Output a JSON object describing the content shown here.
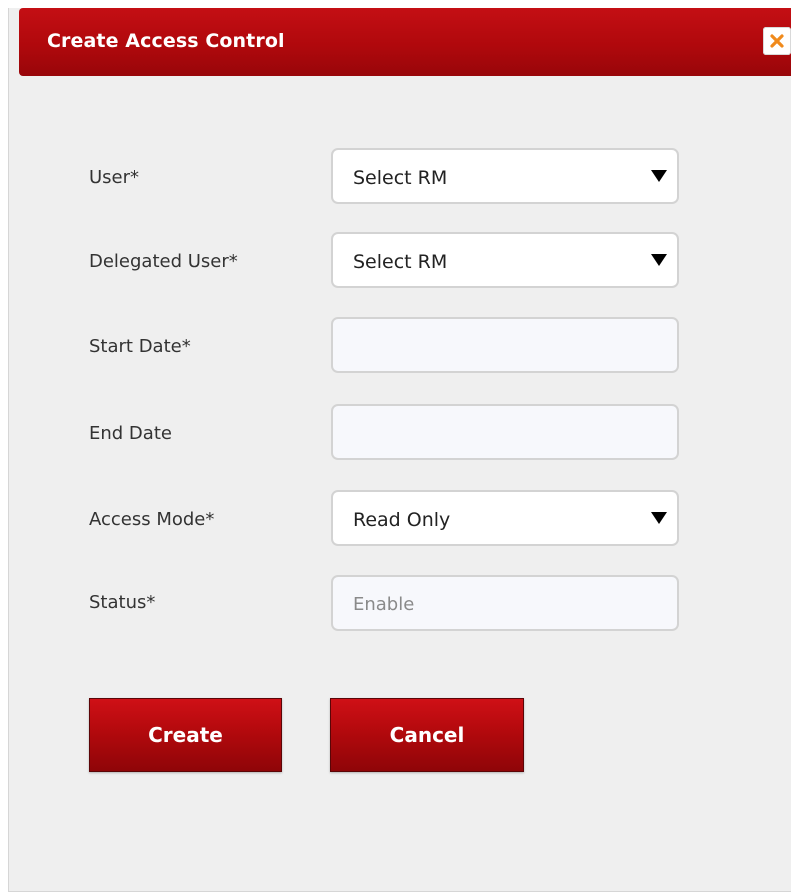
{
  "dialog": {
    "title": "Create Access Control",
    "close_icon": "close-icon"
  },
  "form": {
    "user": {
      "label": "User*",
      "value": "Select RM"
    },
    "delegated_user": {
      "label": "Delegated User*",
      "value": "Select RM"
    },
    "start_date": {
      "label": "Start Date*",
      "value": ""
    },
    "end_date": {
      "label": "End Date",
      "value": ""
    },
    "access_mode": {
      "label": "Access Mode*",
      "value": "Read Only"
    },
    "status": {
      "label": "Status*",
      "placeholder": "Enable"
    }
  },
  "buttons": {
    "create": "Create",
    "cancel": "Cancel"
  },
  "colors": {
    "header": "#b0080c",
    "button": "#b3090d",
    "close_icon": "#f08a1c"
  }
}
